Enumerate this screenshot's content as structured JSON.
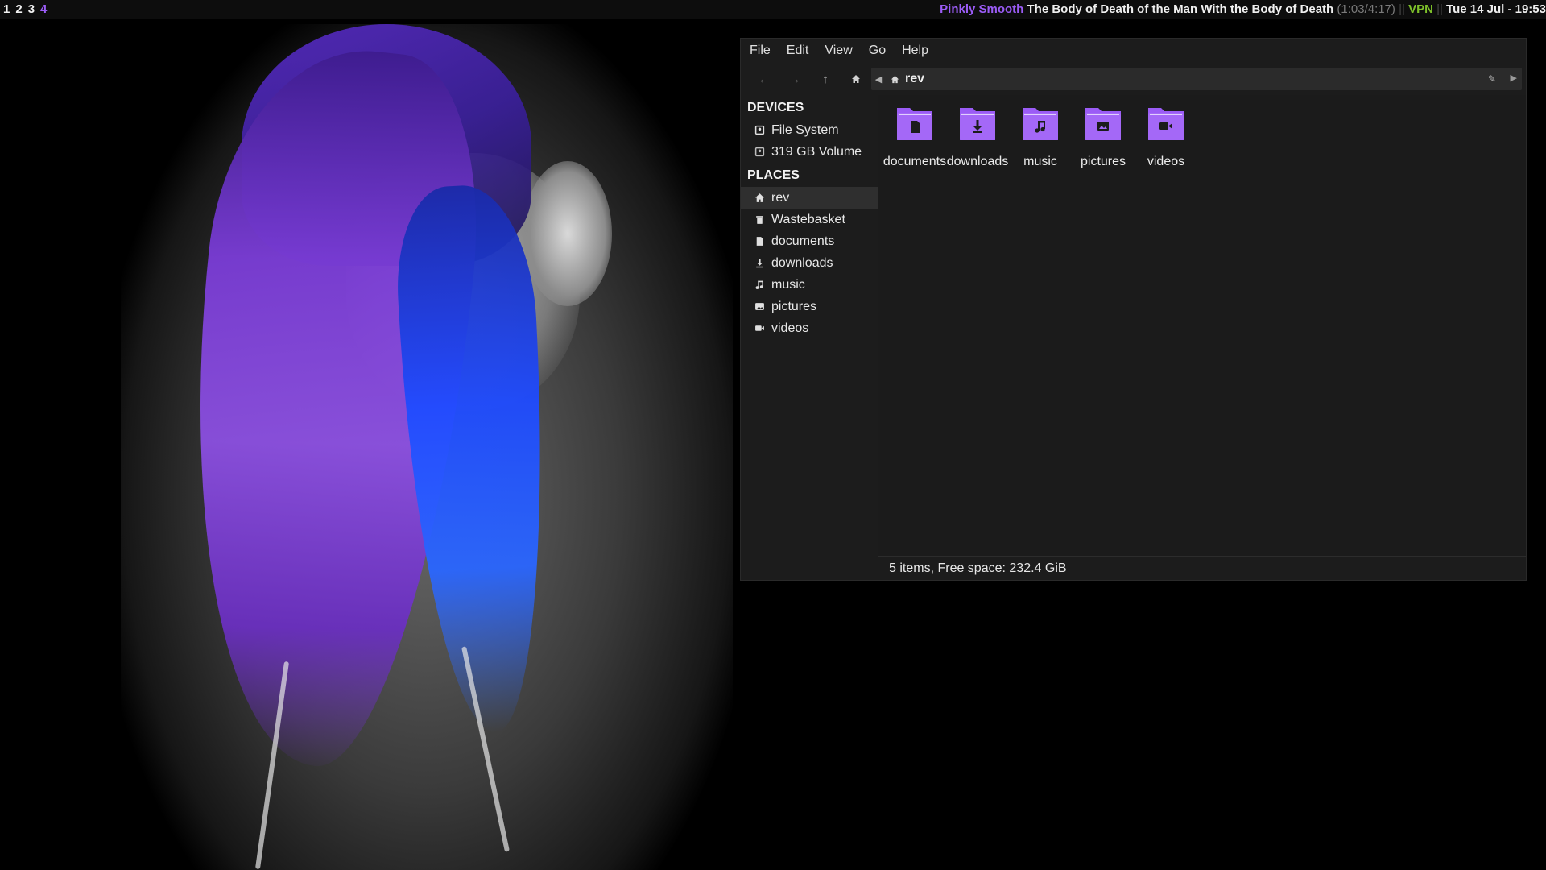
{
  "topbar": {
    "workspaces": [
      "1",
      "2",
      "3",
      "4"
    ],
    "active_workspace": "4",
    "now_playing": {
      "artist": "Pinkly Smooth",
      "track": "The Body of Death of the Man With the Body of Death",
      "time": "(1:03/4:17)"
    },
    "separator": "||",
    "vpn": "VPN",
    "clock": "Tue 14 Jul - 19:53",
    "colors": {
      "accent": "#9b5cf6",
      "vpn": "#7ec12a"
    }
  },
  "window": {
    "menu": [
      "File",
      "Edit",
      "View",
      "Go",
      "Help"
    ],
    "toolbar": {
      "back_icon": "arrow-left-icon",
      "forward_icon": "arrow-right-icon",
      "up_icon": "arrow-up-icon",
      "home_icon": "home-icon"
    },
    "pathbar": {
      "crumb": "rev"
    },
    "sidebar": {
      "devices_title": "DEVICES",
      "devices": [
        {
          "label": "File System",
          "icon": "drive-icon"
        },
        {
          "label": "319 GB Volume",
          "icon": "drive-icon"
        }
      ],
      "places_title": "PLACES",
      "places": [
        {
          "label": "rev",
          "icon": "home-icon",
          "selected": true
        },
        {
          "label": "Wastebasket",
          "icon": "trash-icon"
        },
        {
          "label": "documents",
          "icon": "document-icon"
        },
        {
          "label": "downloads",
          "icon": "download-icon"
        },
        {
          "label": "music",
          "icon": "music-icon"
        },
        {
          "label": "pictures",
          "icon": "picture-icon"
        },
        {
          "label": "videos",
          "icon": "video-icon"
        }
      ]
    },
    "folders": [
      {
        "label": "documents",
        "icon": "folder-documents-icon"
      },
      {
        "label": "downloads",
        "icon": "folder-downloads-icon"
      },
      {
        "label": "music",
        "icon": "folder-music-icon"
      },
      {
        "label": "pictures",
        "icon": "folder-pictures-icon"
      },
      {
        "label": "videos",
        "icon": "folder-videos-icon"
      }
    ],
    "folder_color": "#9b5cf6",
    "status": "5 items, Free space: 232.4 GiB"
  }
}
